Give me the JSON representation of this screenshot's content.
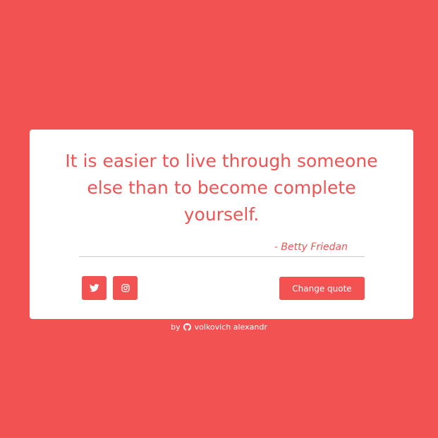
{
  "colors": {
    "background": "#f25252",
    "card": "#ffffff",
    "accent": "#f25252",
    "divider": "#c8c8c8"
  },
  "quote": {
    "text": "It is easier to live through someone else than to become complete yourself.",
    "author": "- Betty Friedan"
  },
  "actions": {
    "twitter_icon": "twitter-icon",
    "instagram_icon": "instagram-icon",
    "change_label": "Change quote"
  },
  "footer": {
    "by": "by",
    "icon": "github-icon",
    "author_link": "volkovich alexandr"
  }
}
